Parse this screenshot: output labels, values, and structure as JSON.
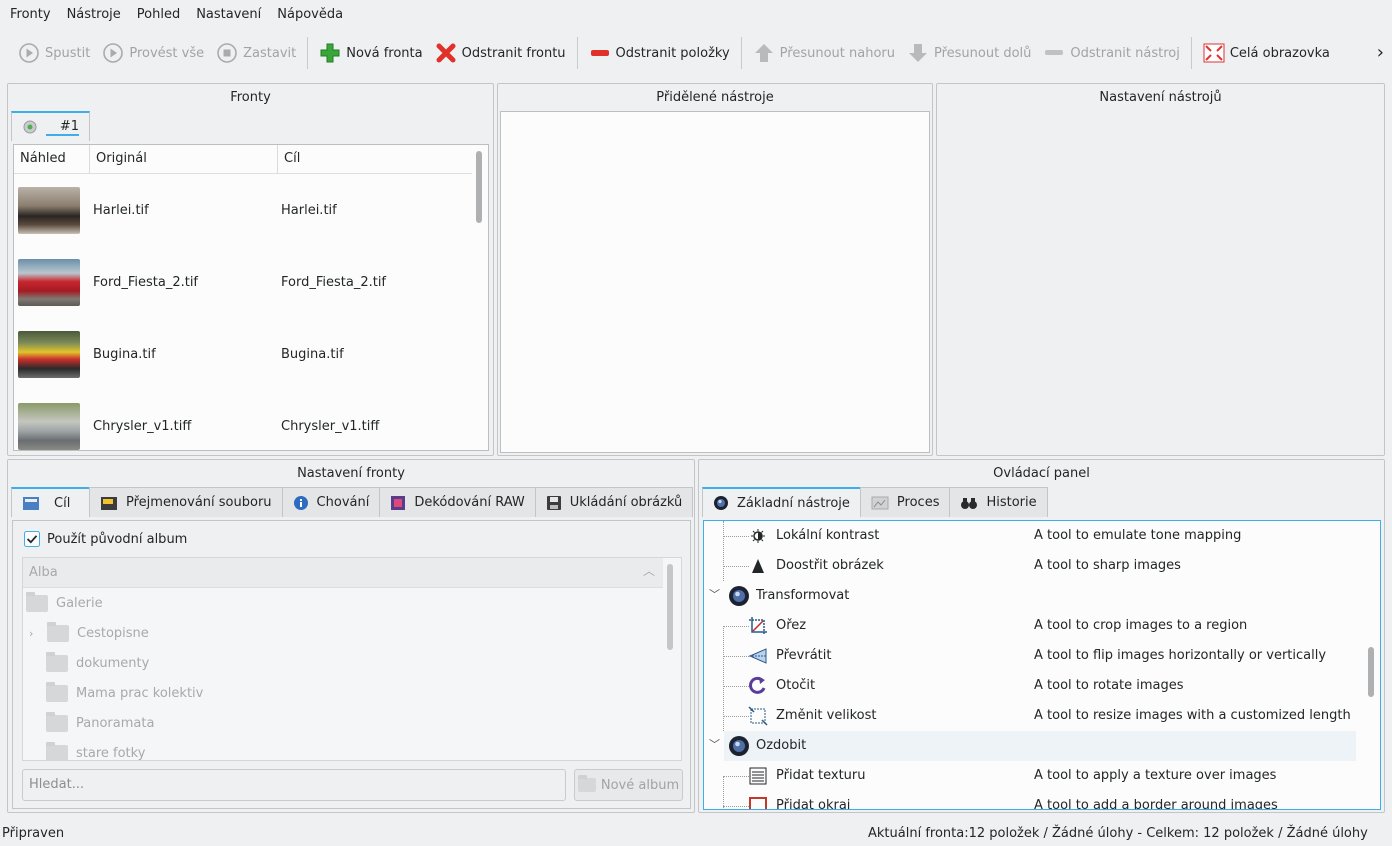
{
  "menu": {
    "items": [
      "Fronty",
      "Nástroje",
      "Pohled",
      "Nastavení",
      "Nápověda"
    ]
  },
  "toolbar": {
    "run": "Spustit",
    "run_all": "Provést vše",
    "stop": "Zastavit",
    "new_queue": "Nová fronta",
    "remove_queue": "Odstranit frontu",
    "remove_items": "Odstranit položky",
    "move_up": "Přesunout nahoru",
    "move_down": "Přesunout dolů",
    "remove_tool": "Odstranit nástroj",
    "fullscreen": "Celá obrazovka",
    "more": "›"
  },
  "queues": {
    "title": "Fronty",
    "tab": "#1",
    "columns": [
      "Náhled",
      "Originál",
      "Cíl"
    ],
    "rows": [
      {
        "original": "Harlei.tif",
        "target": "Harlei.tif"
      },
      {
        "original": "Ford_Fiesta_2.tif",
        "target": "Ford_Fiesta_2.tif"
      },
      {
        "original": "Bugina.tif",
        "target": "Bugina.tif"
      },
      {
        "original": "Chrysler_v1.tiff",
        "target": "Chrysler_v1.tiff"
      }
    ]
  },
  "assigned_tools": {
    "title": "Přidělené nástroje"
  },
  "tool_settings": {
    "title": "Nastavení nástrojů"
  },
  "queue_settings": {
    "title": "Nastavení fronty",
    "tabs": [
      "Cíl",
      "Přejmenování souboru",
      "Chování",
      "Dekódování RAW",
      "Ukládání obrázků"
    ],
    "use_original_album": "Použít původní album",
    "use_original_album_checked": true,
    "albums_header": "Alba",
    "root": "Galerie",
    "folders": [
      "Cestopisne",
      "dokumenty",
      "Mama prac kolektiv",
      "Panoramata",
      "stare fotky"
    ],
    "search_placeholder": "Hledat...",
    "new_album": "Nové album"
  },
  "control_panel": {
    "title": "Ovládací panel",
    "tabs": [
      "Základní nástroje",
      "Proces",
      "Historie"
    ],
    "tools": [
      {
        "name": "Lokální kontrast",
        "desc": "A tool to emulate tone mapping",
        "level": 1,
        "icon": "contrast-icon"
      },
      {
        "name": "Doostřit obrázek",
        "desc": "A tool to sharp images",
        "level": 1,
        "icon": "sharpen-icon"
      },
      {
        "name": "Transformovat",
        "desc": "",
        "level": 0,
        "icon": "lens-icon"
      },
      {
        "name": "Ořez",
        "desc": "A tool to crop images to a region",
        "level": 1,
        "icon": "crop-icon"
      },
      {
        "name": "Převrátit",
        "desc": "A tool to flip images horizontally or vertically",
        "level": 1,
        "icon": "flip-icon"
      },
      {
        "name": "Otočit",
        "desc": "A tool to rotate images",
        "level": 1,
        "icon": "rotate-icon"
      },
      {
        "name": "Změnit velikost",
        "desc": "A tool to resize images with a customized length",
        "level": 1,
        "icon": "resize-icon"
      },
      {
        "name": "Ozdobit",
        "desc": "",
        "level": 0,
        "icon": "lens-icon"
      },
      {
        "name": "Přidat texturu",
        "desc": "A tool to apply a texture over images",
        "level": 1,
        "icon": "texture-icon"
      },
      {
        "name": "Přidat okraj",
        "desc": "A tool to add a border around images",
        "level": 1,
        "icon": "border-icon"
      }
    ]
  },
  "status": {
    "left": "Připraven",
    "right": "Aktuální fronta:12 položek / Žádné úlohy - Celkem: 12 položek / Žádné úlohy"
  }
}
